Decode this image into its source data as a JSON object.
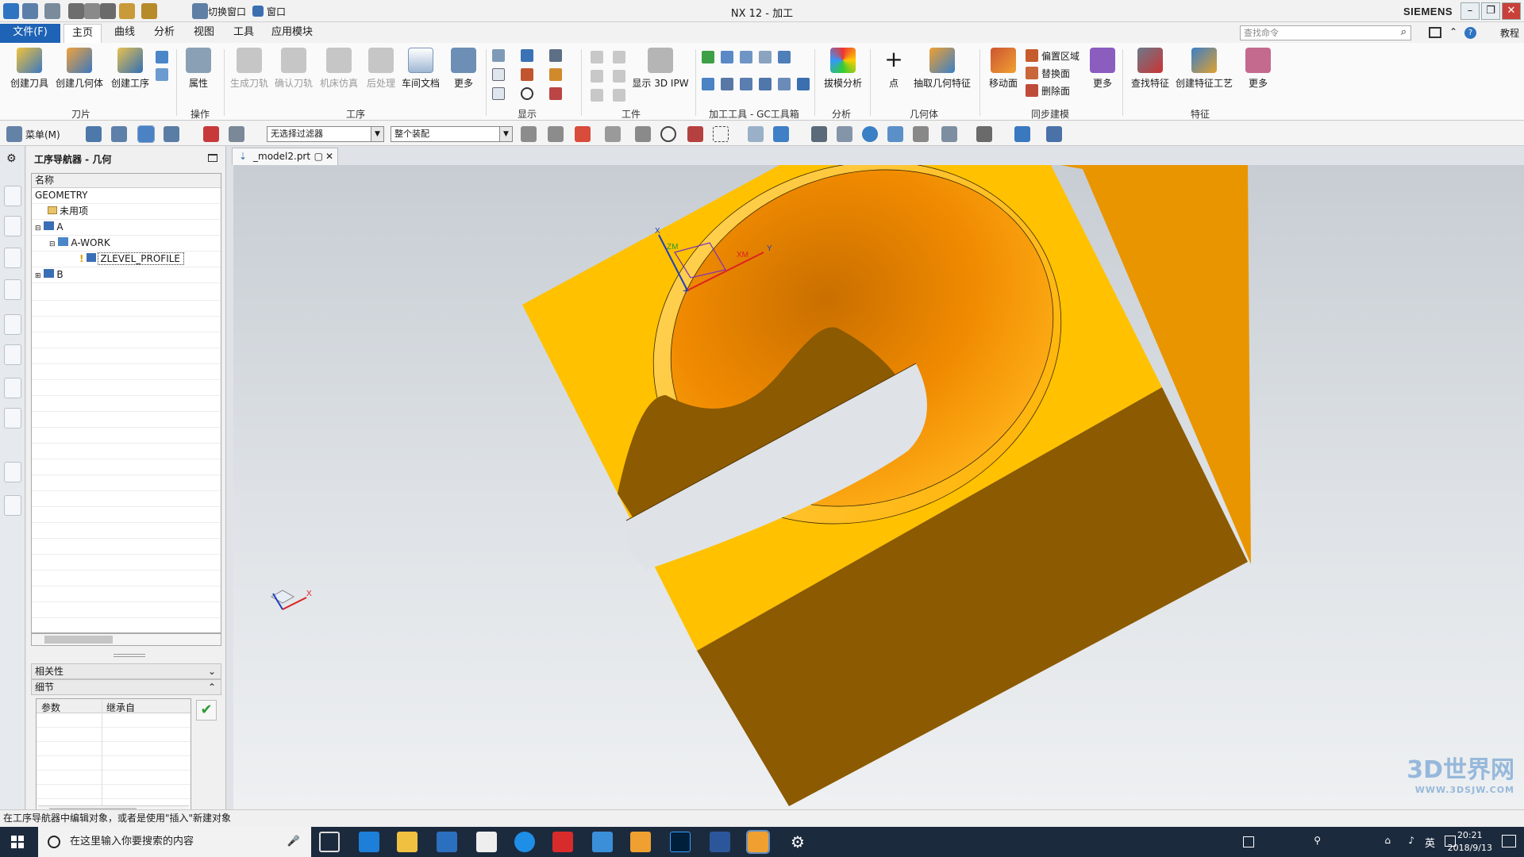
{
  "titlebar": {
    "switch_window": "切换窗口",
    "window": "窗口",
    "app_title": "NX 12 - 加工",
    "brand": "SIEMENS"
  },
  "ribbon_tabs": [
    "文件(F)",
    "主页",
    "曲线",
    "分析",
    "视图",
    "工具",
    "应用模块"
  ],
  "command_search_placeholder": "查找命令",
  "help_label": "教程",
  "ribbon": {
    "create_tool": "创建刀具",
    "create_geometry": "创建几何体",
    "create_operation": "创建工序",
    "properties": "属性",
    "generate_toolpath": "生成刀轨",
    "verify_toolpath": "确认刀轨",
    "machine_sim": "机床仿真",
    "postprocess": "后处理",
    "shop_doc": "车间文档",
    "more1": "更多",
    "show_3d_ipw": "显示 3D IPW",
    "draft_analysis": "拔模分析",
    "point": "点",
    "extract_geometry": "抽取几何特征",
    "move_face": "移动面",
    "offset_region": "偏置区域",
    "replace_face": "替换面",
    "delete_face": "删除面",
    "more2": "更多",
    "find_feature": "查找特征",
    "create_feature_process": "创建特征工艺",
    "more3": "更多",
    "groups": {
      "tool": "刀片",
      "operate": "操作",
      "operation": "工序",
      "display": "显示",
      "workpiece": "工件",
      "toolbox": "加工工具 - GC工具箱",
      "analysis": "分析",
      "geometry": "几何体",
      "sync": "同步建模",
      "feature": "特征"
    }
  },
  "toolbar2": {
    "menu": "菜单(M)",
    "filter": "无选择过滤器",
    "assembly": "整个装配"
  },
  "navigator": {
    "title": "工序导航器 - 几何",
    "column": "名称",
    "rows": [
      "GEOMETRY",
      "未用项",
      "A",
      "A-WORK",
      "ZLEVEL_PROFILE",
      "B"
    ],
    "dependencies": "相关性",
    "details": "细节",
    "param_col": "参数",
    "inherit_col": "继承自"
  },
  "document_tab": "_model2.prt",
  "triad": {
    "x": "X",
    "y": "Y",
    "zm": "ZM",
    "xm": "XM"
  },
  "status": "在工序导航器中编辑对象，或者是使用\"插入\"新建对象",
  "taskbar": {
    "search": "在这里输入你要搜索的内容",
    "time": "20:21",
    "date": "2018/9/13",
    "ime": "英"
  },
  "watermark": {
    "main": "3D世界网",
    "sub": "WWW.3DSJW.COM"
  },
  "colors": {
    "part_top": "#ffc100",
    "part_front": "#8c5a00",
    "file_tab": "#1e63b5",
    "taskbar": "#1c2a3d"
  }
}
